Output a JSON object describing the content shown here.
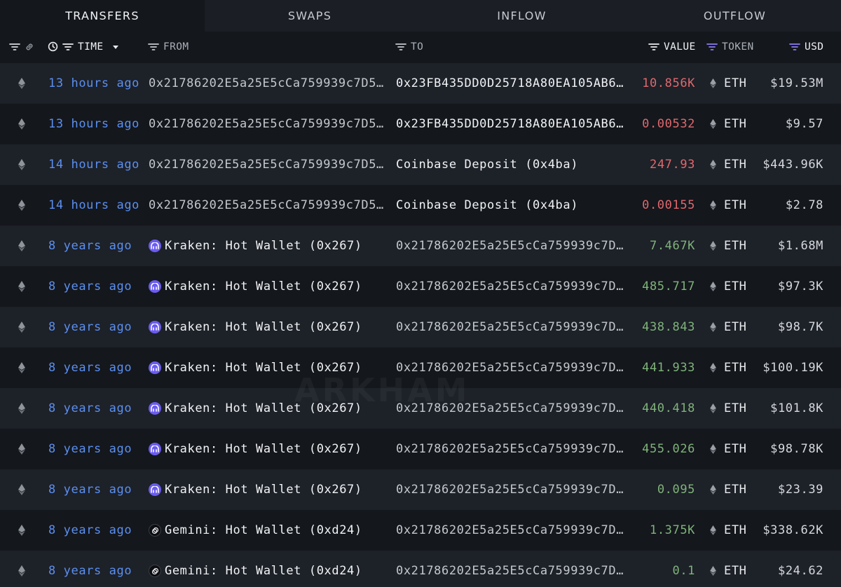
{
  "tabs": [
    {
      "label": "TRANSFERS",
      "active": true
    },
    {
      "label": "SWAPS",
      "active": false
    },
    {
      "label": "INFLOW",
      "active": false
    },
    {
      "label": "OUTFLOW",
      "active": false
    }
  ],
  "columns": {
    "time": "TIME",
    "from": "FROM",
    "to": "TO",
    "value": "VALUE",
    "token": "TOKEN",
    "usd": "USD"
  },
  "colors": {
    "accent_blue": "#5b8ff0",
    "value_out": "#e0686d",
    "value_in": "#7fb37a",
    "filter_purple": "#8a7cf0",
    "kraken": "#6b5cf0"
  },
  "watermark": "ARKHAM",
  "rows": [
    {
      "time": "13 hours ago",
      "from": "0x21786202E5a25E5cCa759939c7D56…",
      "from_entity": null,
      "to": "0x23FB435DD0D25718A80EA105AB63C…",
      "to_is_entity": true,
      "value": "10.856K",
      "direction": "out",
      "token": "ETH",
      "usd": "$19.53M"
    },
    {
      "time": "13 hours ago",
      "from": "0x21786202E5a25E5cCa759939c7D56…",
      "from_entity": null,
      "to": "0x23FB435DD0D25718A80EA105AB63C…",
      "to_is_entity": true,
      "value": "0.00532",
      "direction": "out",
      "token": "ETH",
      "usd": "$9.57"
    },
    {
      "time": "14 hours ago",
      "from": "0x21786202E5a25E5cCa759939c7D56…",
      "from_entity": null,
      "to": "Coinbase Deposit (0x4ba)",
      "to_is_entity": true,
      "value": "247.93",
      "direction": "out",
      "token": "ETH",
      "usd": "$443.96K"
    },
    {
      "time": "14 hours ago",
      "from": "0x21786202E5a25E5cCa759939c7D56…",
      "from_entity": null,
      "to": "Coinbase Deposit (0x4ba)",
      "to_is_entity": true,
      "value": "0.00155",
      "direction": "out",
      "token": "ETH",
      "usd": "$2.78"
    },
    {
      "time": "8 years ago",
      "from": "Kraken: Hot Wallet (0x267)",
      "from_entity": "kraken",
      "to": "0x21786202E5a25E5cCa759939c7D56…",
      "to_is_entity": false,
      "value": "7.467K",
      "direction": "in",
      "token": "ETH",
      "usd": "$1.68M"
    },
    {
      "time": "8 years ago",
      "from": "Kraken: Hot Wallet (0x267)",
      "from_entity": "kraken",
      "to": "0x21786202E5a25E5cCa759939c7D56…",
      "to_is_entity": false,
      "value": "485.717",
      "direction": "in",
      "token": "ETH",
      "usd": "$97.3K"
    },
    {
      "time": "8 years ago",
      "from": "Kraken: Hot Wallet (0x267)",
      "from_entity": "kraken",
      "to": "0x21786202E5a25E5cCa759939c7D56…",
      "to_is_entity": false,
      "value": "438.843",
      "direction": "in",
      "token": "ETH",
      "usd": "$98.7K"
    },
    {
      "time": "8 years ago",
      "from": "Kraken: Hot Wallet (0x267)",
      "from_entity": "kraken",
      "to": "0x21786202E5a25E5cCa759939c7D56…",
      "to_is_entity": false,
      "value": "441.933",
      "direction": "in",
      "token": "ETH",
      "usd": "$100.19K"
    },
    {
      "time": "8 years ago",
      "from": "Kraken: Hot Wallet (0x267)",
      "from_entity": "kraken",
      "to": "0x21786202E5a25E5cCa759939c7D56…",
      "to_is_entity": false,
      "value": "440.418",
      "direction": "in",
      "token": "ETH",
      "usd": "$101.8K"
    },
    {
      "time": "8 years ago",
      "from": "Kraken: Hot Wallet (0x267)",
      "from_entity": "kraken",
      "to": "0x21786202E5a25E5cCa759939c7D56…",
      "to_is_entity": false,
      "value": "455.026",
      "direction": "in",
      "token": "ETH",
      "usd": "$98.78K"
    },
    {
      "time": "8 years ago",
      "from": "Kraken: Hot Wallet (0x267)",
      "from_entity": "kraken",
      "to": "0x21786202E5a25E5cCa759939c7D56…",
      "to_is_entity": false,
      "value": "0.095",
      "direction": "in",
      "token": "ETH",
      "usd": "$23.39"
    },
    {
      "time": "8 years ago",
      "from": "Gemini: Hot Wallet (0xd24)",
      "from_entity": "gemini",
      "to": "0x21786202E5a25E5cCa759939c7D56…",
      "to_is_entity": false,
      "value": "1.375K",
      "direction": "in",
      "token": "ETH",
      "usd": "$338.62K"
    },
    {
      "time": "8 years ago",
      "from": "Gemini: Hot Wallet (0xd24)",
      "from_entity": "gemini",
      "to": "0x21786202E5a25E5cCa759939c7D56…",
      "to_is_entity": false,
      "value": "0.1",
      "direction": "in",
      "token": "ETH",
      "usd": "$24.62"
    }
  ]
}
